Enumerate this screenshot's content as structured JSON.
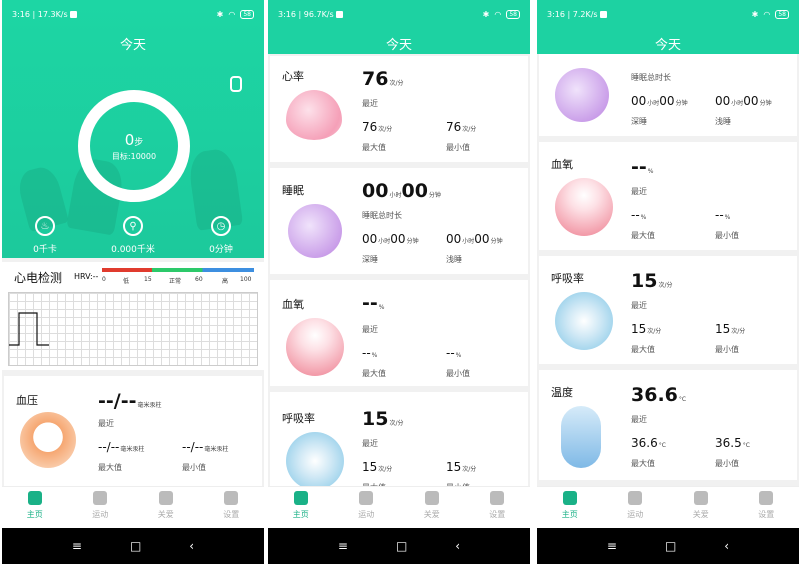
{
  "phones": [
    {
      "status": {
        "time": "3:16",
        "speed": "17.3K/s",
        "battery": "58"
      }
    },
    {
      "status": {
        "time": "3:16",
        "speed": "96.7K/s",
        "battery": "58"
      }
    },
    {
      "status": {
        "time": "3:16",
        "speed": "7.2K/s",
        "battery": "58"
      }
    }
  ],
  "title": "今天",
  "hero": {
    "steps": "0",
    "steps_unit": "步",
    "goal": "目标:10000",
    "calories": "0千卡",
    "distance": "0.000千米",
    "duration": "0分钟"
  },
  "ecg": {
    "label": "心电检测",
    "hrv": "HRV:--",
    "ticks": [
      "0",
      "低",
      "15",
      "正常",
      "60",
      "高",
      "100"
    ]
  },
  "labels": {
    "recent": "最近",
    "max": "最大值",
    "min": "最小值",
    "total_sleep": "睡眠总时长",
    "deep": "深睡",
    "light": "浅睡"
  },
  "units": {
    "mmhg": "毫米汞柱",
    "per_min": "次/分",
    "hour": "小时",
    "minute": "分钟",
    "percent": "%",
    "celsius": "°C"
  },
  "blood_pressure": {
    "name": "血压",
    "value": "--/--",
    "max": "--/--",
    "min": "--/--"
  },
  "heart_rate": {
    "name": "心率",
    "value": "76",
    "max": "76",
    "min": "76"
  },
  "sleep": {
    "name": "睡眠",
    "hours": "00",
    "minutes": "00",
    "deep_h": "00",
    "deep_m": "00",
    "light_h": "00",
    "light_m": "00"
  },
  "spo2": {
    "name": "血氧",
    "value": "--",
    "max": "--",
    "min": "--"
  },
  "resp": {
    "name": "呼吸率",
    "value": "15",
    "max": "15",
    "min": "15"
  },
  "temp": {
    "name": "温度",
    "value": "36.6",
    "max": "36.6",
    "min": "36.5"
  },
  "nav": [
    "主页",
    "运动",
    "关爱",
    "设置"
  ],
  "colors": {
    "accent": "#1dd2a2",
    "nav_active": "#1ab187",
    "heart": "#f5a0b8",
    "sleep": "#c89be8",
    "spo2": "#f29aa8",
    "resp": "#8ccbe8",
    "temp": "#7fb9e6",
    "bp": "#f6a772"
  }
}
